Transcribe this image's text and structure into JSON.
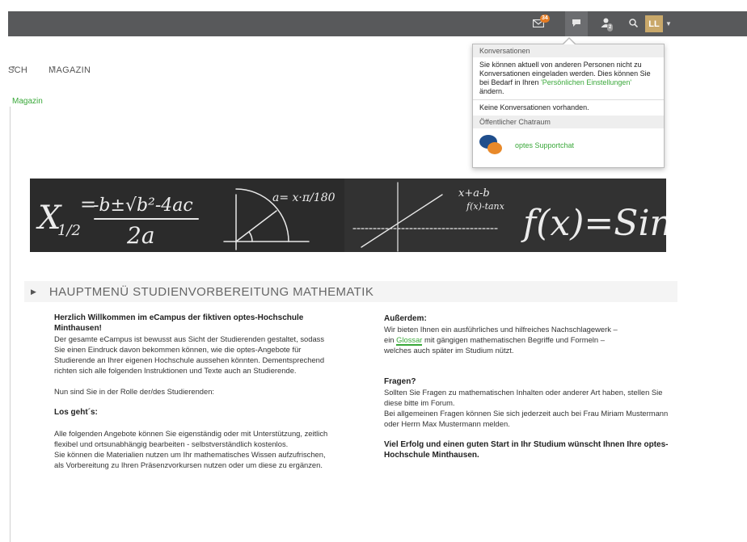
{
  "topbar": {
    "mail_badge": "34",
    "user_badge": "2",
    "avatar_initials": "LL"
  },
  "nav": {
    "item1": "SCH",
    "item2": "MAGAZIN",
    "sublink": "Magazin"
  },
  "popover": {
    "header": "Konversationen",
    "text_before": "Sie können aktuell von anderen Personen nicht zu Konversationen eingeladen werden. Dies können Sie bei Bedarf in Ihren ",
    "settings_link": "'Persönlichen Einstellungen'",
    "text_after": " ändern.",
    "empty_text": "Keine Konversationen vorhanden.",
    "public_header": "Öffentlicher Chatraum",
    "chat_link": "optes Supportchat"
  },
  "section": {
    "title": "HAUPTMENÜ STUDIENVORBEREITUNG MATHEMATIK"
  },
  "left": {
    "welcome_title": "Herzlich Willkommen im eCampus der fiktiven optes-Hochschule Minthausen!",
    "welcome_text": "Der gesamte eCampus ist bewusst aus Sicht der Studierenden gestaltet, sodass Sie einen Eindruck davon bekommen können, wie die optes-Angebote für Studierende an Ihrer eigenen Hochschule aussehen könnten. Dementsprechend richten sich alle folgenden Instruktionen und Texte auch an Studierende.",
    "role_text": "Nun sind Sie in der Rolle der/des Studierenden:",
    "lets_go": "Los geht´s:",
    "offers_text": "Alle folgenden Angebote können Sie eigenständig oder mit Unterstützung, zeitlich flexibel und ortsunabhängig bearbeiten - selbstverständlich kostenlos.",
    "materials_text": "Sie können die Materialien nutzen um Ihr mathematisches Wissen aufzufrischen, als Vorbereitung zu Ihren Präsenzvorkursen nutzen oder um diese zu ergänzen."
  },
  "right": {
    "besides_title": "Außerdem:",
    "besides_text1": "Wir bieten Ihnen ein ausführliches und hilfreiches Nachschlagewerk –",
    "besides_text2a": " ein ",
    "glossary_link": "Glossar",
    "besides_text2b": " mit gängigen mathematischen Begriffe und Formeln –",
    "besides_text3": "welches auch später im Studium nützt.",
    "questions_title": "Fragen?",
    "questions_text1": "Sollten Sie Fragen zu mathematischen Inhalten oder anderer Art haben, stellen Sie diese bitte im Forum.",
    "questions_text2": "Bei allgemeinen Fragen können Sie sich jederzeit auch bei Frau Miriam Mustermann oder Herrn Max Mustermann melden.",
    "closing": "Viel Erfolg und einen guten Start in Ihr Studium wünscht Ihnen Ihre optes-Hochschule Minthausen."
  },
  "colors": {
    "topbar": "#58595b",
    "accent_green": "#3aa83a",
    "badge_orange": "#e57b22",
    "avatar": "#c9a86a"
  }
}
